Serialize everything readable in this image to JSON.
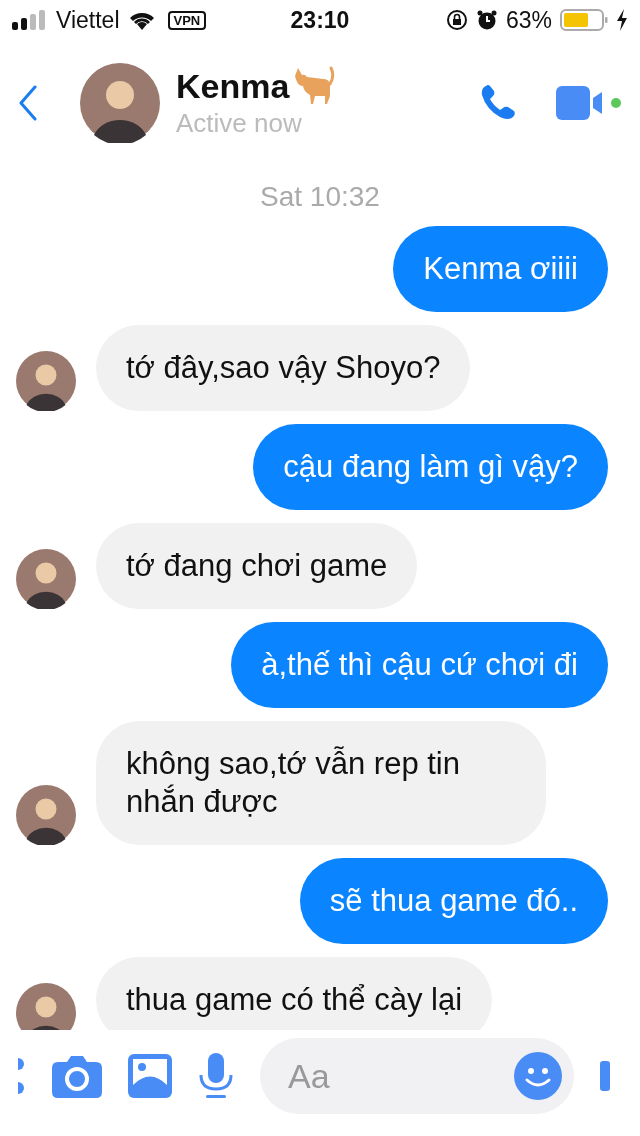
{
  "status_bar": {
    "carrier": "Viettel",
    "vpn": "VPN",
    "time": "23:10",
    "battery_percent": "63%"
  },
  "header": {
    "name": "Kenma",
    "status": "Active now"
  },
  "messages": [
    {
      "kind": "timestamp",
      "text": "Sat 10:32"
    },
    {
      "kind": "outgoing",
      "text": "Kenma ơiiii"
    },
    {
      "kind": "incoming",
      "text": "tớ đây,sao vậy Shoyo?"
    },
    {
      "kind": "outgoing",
      "text": "cậu đang làm gì vậy?"
    },
    {
      "kind": "incoming",
      "text": "tớ đang chơi game"
    },
    {
      "kind": "outgoing",
      "text": "à,thế thì cậu cứ chơi đi"
    },
    {
      "kind": "incoming",
      "text": "không sao,tớ vẫn rep tin nhắn được"
    },
    {
      "kind": "outgoing",
      "text": "sẽ thua game đó.."
    },
    {
      "kind": "incoming",
      "text": "thua game có thể cày lại"
    }
  ],
  "composer": {
    "placeholder": "Aa"
  }
}
